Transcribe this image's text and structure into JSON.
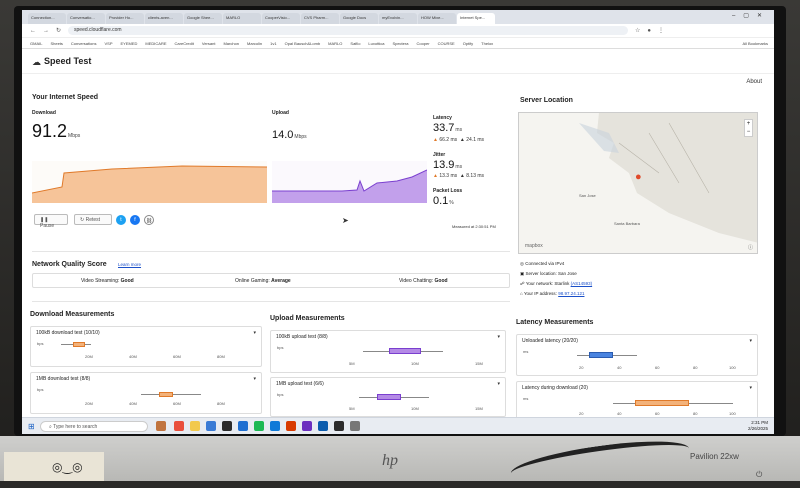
{
  "browser": {
    "tabs": [
      "Connection...",
      "Conversatio...",
      "Provider Ho...",
      "clients-aven...",
      "Google Shee...",
      "MARLO",
      "CooperVisio...",
      "CVS Pharm...",
      "Google Docs",
      "myEvolvin...",
      "HOW Mixe...",
      "Internet Spe..."
    ],
    "active_tab_index": 11,
    "url": "speed.cloudflare.com",
    "bookmarks": [
      "GMAIL",
      "Sheets",
      "Conversations",
      "VSP",
      "EYEMED",
      "MEDICARE",
      "CareCredit",
      "Versant",
      "Marchon",
      "Marcolin",
      "1v1",
      "Opal Bausch&Lomb",
      "MARLO",
      "Safilo",
      "Luxottica",
      "Spectera",
      "Cooper",
      "COURSE",
      "Optify",
      "Thelox",
      "All Bookmarks"
    ]
  },
  "header": {
    "title": "Speed Test",
    "about": "About"
  },
  "speed": {
    "section_title": "Your Internet Speed",
    "download_label": "Download",
    "download_value": "91.2",
    "download_unit": "Mbps",
    "upload_label": "Upload",
    "upload_value": "14.0",
    "upload_unit": "Mbps",
    "latency_label": "Latency",
    "latency_value": "33.7",
    "latency_unit": "ms",
    "latency_up": "66.2",
    "latency_down": "24.1",
    "latency_sub_unit": "ms",
    "jitter_label": "Jitter",
    "jitter_value": "13.9",
    "jitter_unit": "ms",
    "jitter_up": "13.3",
    "jitter_down": "8.13",
    "jitter_sub_unit": "ms",
    "loss_label": "Packet Loss",
    "loss_value": "0.1",
    "loss_unit": "%",
    "measured_at": "Measured at 2:30:51 PM",
    "pause_label": "Pause",
    "retest_label": "Retest",
    "colors": {
      "download": "#f08a3a",
      "upload": "#8a4fd6"
    }
  },
  "server": {
    "title": "Server Location",
    "connected_via": "Connected via IPv4",
    "server_location": "Server location: San Jose",
    "network_label": "Your network: Starlink",
    "network_asn": "(AS14593)",
    "ip_label": "Your IP address:",
    "ip_value": "98.97.24.121",
    "map_cities": [
      "San Jose",
      "Santa Barbara",
      "San Francisco",
      "Oakland"
    ],
    "map_attribution": "mapbox"
  },
  "quality": {
    "title": "Network Quality Score",
    "learn_more": "Learn more",
    "video_streaming_label": "Video Streaming:",
    "video_streaming_value": "Good",
    "gaming_label": "Online Gaming:",
    "gaming_value": "Average",
    "chatting_label": "Video Chatting:",
    "chatting_value": "Good"
  },
  "download_measurements": {
    "title": "Download Measurements",
    "tests": [
      {
        "label": "100kB download test",
        "count": "(10/10)",
        "ticks": [
          "20M",
          "40M",
          "60M",
          "80M"
        ]
      },
      {
        "label": "1MB download test",
        "count": "(8/8)",
        "ticks": [
          "20M",
          "40M",
          "60M",
          "80M"
        ]
      }
    ],
    "unit": "bps"
  },
  "upload_measurements": {
    "title": "Upload Measurements",
    "tests": [
      {
        "label": "100kB upload test",
        "count": "(8/8)",
        "ticks": [
          "5M",
          "10M",
          "15M"
        ]
      },
      {
        "label": "1MB upload test",
        "count": "(6/6)",
        "ticks": [
          "5M",
          "10M",
          "15M"
        ]
      }
    ],
    "unit": "bps"
  },
  "latency_measurements": {
    "title": "Latency Measurements",
    "tests": [
      {
        "label": "Unloaded latency",
        "count": "(20/20)",
        "ticks": [
          "20",
          "40",
          "60",
          "80",
          "100"
        ]
      },
      {
        "label": "Latency during download",
        "count": "(20)",
        "ticks": [
          "20",
          "40",
          "60",
          "80",
          "100"
        ]
      }
    ],
    "unit": "ms"
  },
  "taskbar": {
    "search": "Type here to search",
    "time": "2:31 PM",
    "date": "2/26/2025"
  },
  "monitor": {
    "brand": "hp",
    "model": "Pavilion 22xw"
  }
}
